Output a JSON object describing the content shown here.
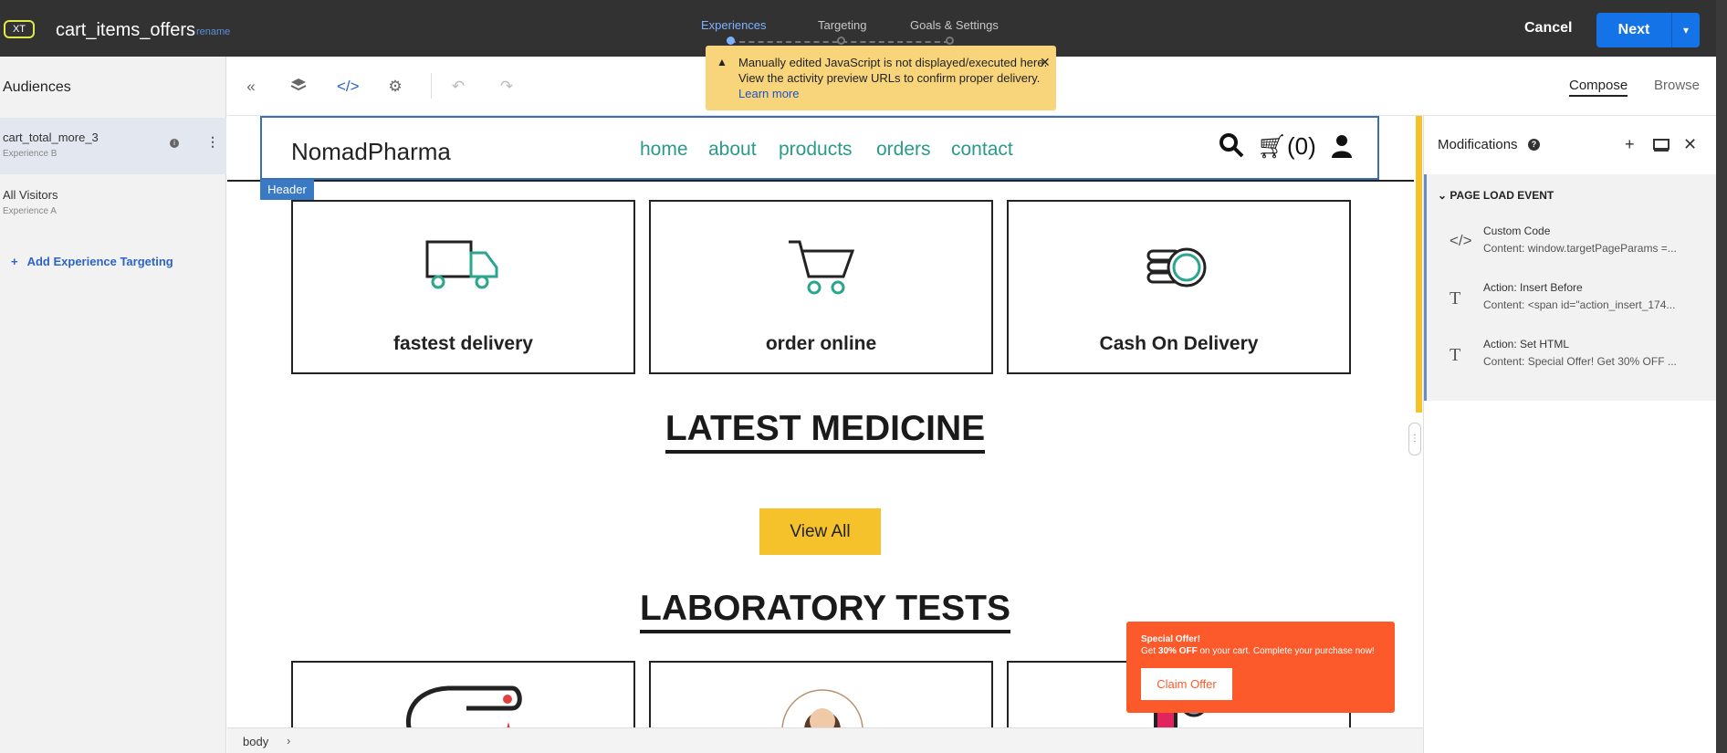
{
  "topbar": {
    "badge": "XT",
    "activity_name": "cart_items_offers",
    "rename": "rename",
    "steps": [
      "Experiences",
      "Targeting",
      "Goals & Settings"
    ],
    "active_step": 0,
    "cancel": "Cancel",
    "next": "Next"
  },
  "audiences": {
    "title": "Audiences",
    "items": [
      {
        "name": "cart_total_more_3",
        "experience": "Experience B",
        "selected": true
      },
      {
        "name": "All Visitors",
        "experience": "Experience A",
        "selected": false
      }
    ],
    "add_targeting": "Add Experience Targeting"
  },
  "toolbar": {
    "icons": [
      "collapse-icon",
      "layers-icon",
      "code-icon",
      "settings-icon",
      "undo-icon",
      "redo-icon"
    ],
    "compose": "Compose",
    "browse": "Browse"
  },
  "toast": {
    "line1": "Manually edited JavaScript is not displayed/executed here.",
    "line2": "View the activity preview URLs to confirm proper delivery.",
    "link": "Learn more"
  },
  "site": {
    "brand": "NomadPharma",
    "nav": [
      "home",
      "about",
      "products",
      "orders",
      "contact"
    ],
    "cart_count": "(0)",
    "header_tag": "Header",
    "features": [
      "fastest delivery",
      "order online",
      "Cash On Delivery"
    ],
    "latest_title": "LATEST MEDICINE",
    "view_all": "View All",
    "lab_title": "LABORATORY TESTS"
  },
  "offer": {
    "title": "Special Offer!",
    "text_pre": "Get ",
    "text_bold": "30% OFF",
    "text_post": " on your cart. Complete your purchase now!",
    "button": "Claim Offer"
  },
  "status": {
    "breadcrumb": "body",
    "chevron": "›"
  },
  "modifications": {
    "title": "Modifications",
    "event": "PAGE LOAD EVENT",
    "items": [
      {
        "icon": "code-icon",
        "name": "Custom Code",
        "content": "Content: window.targetPageParams =..."
      },
      {
        "icon": "text-icon",
        "name": "Action: Insert Before",
        "content": "Content: <span id=\"action_insert_174..."
      },
      {
        "icon": "text-icon",
        "name": "Action: Set HTML",
        "content": "Content: Special Offer! Get 30% OFF ..."
      }
    ]
  },
  "colors": {
    "topbar": "#323232",
    "primary": "#1473e6",
    "toast": "#f8d47a",
    "nav": "#2a9a8a",
    "offer": "#fc5a2b",
    "view_all": "#f6c22b"
  }
}
